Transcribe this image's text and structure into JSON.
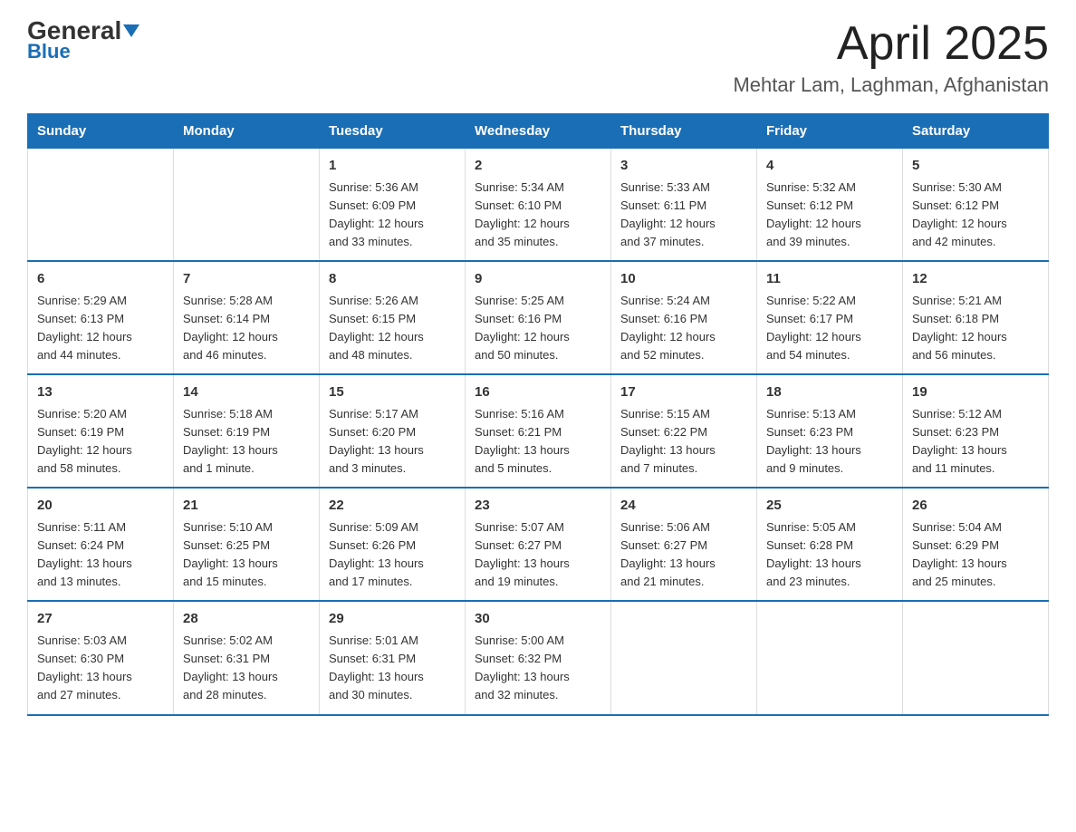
{
  "header": {
    "logo_general": "General",
    "logo_blue": "Blue",
    "month_title": "April 2025",
    "location": "Mehtar Lam, Laghman, Afghanistan"
  },
  "days_of_week": [
    "Sunday",
    "Monday",
    "Tuesday",
    "Wednesday",
    "Thursday",
    "Friday",
    "Saturday"
  ],
  "weeks": [
    [
      {
        "day": "",
        "details": []
      },
      {
        "day": "",
        "details": []
      },
      {
        "day": "1",
        "details": [
          "Sunrise: 5:36 AM",
          "Sunset: 6:09 PM",
          "Daylight: 12 hours",
          "and 33 minutes."
        ]
      },
      {
        "day": "2",
        "details": [
          "Sunrise: 5:34 AM",
          "Sunset: 6:10 PM",
          "Daylight: 12 hours",
          "and 35 minutes."
        ]
      },
      {
        "day": "3",
        "details": [
          "Sunrise: 5:33 AM",
          "Sunset: 6:11 PM",
          "Daylight: 12 hours",
          "and 37 minutes."
        ]
      },
      {
        "day": "4",
        "details": [
          "Sunrise: 5:32 AM",
          "Sunset: 6:12 PM",
          "Daylight: 12 hours",
          "and 39 minutes."
        ]
      },
      {
        "day": "5",
        "details": [
          "Sunrise: 5:30 AM",
          "Sunset: 6:12 PM",
          "Daylight: 12 hours",
          "and 42 minutes."
        ]
      }
    ],
    [
      {
        "day": "6",
        "details": [
          "Sunrise: 5:29 AM",
          "Sunset: 6:13 PM",
          "Daylight: 12 hours",
          "and 44 minutes."
        ]
      },
      {
        "day": "7",
        "details": [
          "Sunrise: 5:28 AM",
          "Sunset: 6:14 PM",
          "Daylight: 12 hours",
          "and 46 minutes."
        ]
      },
      {
        "day": "8",
        "details": [
          "Sunrise: 5:26 AM",
          "Sunset: 6:15 PM",
          "Daylight: 12 hours",
          "and 48 minutes."
        ]
      },
      {
        "day": "9",
        "details": [
          "Sunrise: 5:25 AM",
          "Sunset: 6:16 PM",
          "Daylight: 12 hours",
          "and 50 minutes."
        ]
      },
      {
        "day": "10",
        "details": [
          "Sunrise: 5:24 AM",
          "Sunset: 6:16 PM",
          "Daylight: 12 hours",
          "and 52 minutes."
        ]
      },
      {
        "day": "11",
        "details": [
          "Sunrise: 5:22 AM",
          "Sunset: 6:17 PM",
          "Daylight: 12 hours",
          "and 54 minutes."
        ]
      },
      {
        "day": "12",
        "details": [
          "Sunrise: 5:21 AM",
          "Sunset: 6:18 PM",
          "Daylight: 12 hours",
          "and 56 minutes."
        ]
      }
    ],
    [
      {
        "day": "13",
        "details": [
          "Sunrise: 5:20 AM",
          "Sunset: 6:19 PM",
          "Daylight: 12 hours",
          "and 58 minutes."
        ]
      },
      {
        "day": "14",
        "details": [
          "Sunrise: 5:18 AM",
          "Sunset: 6:19 PM",
          "Daylight: 13 hours",
          "and 1 minute."
        ]
      },
      {
        "day": "15",
        "details": [
          "Sunrise: 5:17 AM",
          "Sunset: 6:20 PM",
          "Daylight: 13 hours",
          "and 3 minutes."
        ]
      },
      {
        "day": "16",
        "details": [
          "Sunrise: 5:16 AM",
          "Sunset: 6:21 PM",
          "Daylight: 13 hours",
          "and 5 minutes."
        ]
      },
      {
        "day": "17",
        "details": [
          "Sunrise: 5:15 AM",
          "Sunset: 6:22 PM",
          "Daylight: 13 hours",
          "and 7 minutes."
        ]
      },
      {
        "day": "18",
        "details": [
          "Sunrise: 5:13 AM",
          "Sunset: 6:23 PM",
          "Daylight: 13 hours",
          "and 9 minutes."
        ]
      },
      {
        "day": "19",
        "details": [
          "Sunrise: 5:12 AM",
          "Sunset: 6:23 PM",
          "Daylight: 13 hours",
          "and 11 minutes."
        ]
      }
    ],
    [
      {
        "day": "20",
        "details": [
          "Sunrise: 5:11 AM",
          "Sunset: 6:24 PM",
          "Daylight: 13 hours",
          "and 13 minutes."
        ]
      },
      {
        "day": "21",
        "details": [
          "Sunrise: 5:10 AM",
          "Sunset: 6:25 PM",
          "Daylight: 13 hours",
          "and 15 minutes."
        ]
      },
      {
        "day": "22",
        "details": [
          "Sunrise: 5:09 AM",
          "Sunset: 6:26 PM",
          "Daylight: 13 hours",
          "and 17 minutes."
        ]
      },
      {
        "day": "23",
        "details": [
          "Sunrise: 5:07 AM",
          "Sunset: 6:27 PM",
          "Daylight: 13 hours",
          "and 19 minutes."
        ]
      },
      {
        "day": "24",
        "details": [
          "Sunrise: 5:06 AM",
          "Sunset: 6:27 PM",
          "Daylight: 13 hours",
          "and 21 minutes."
        ]
      },
      {
        "day": "25",
        "details": [
          "Sunrise: 5:05 AM",
          "Sunset: 6:28 PM",
          "Daylight: 13 hours",
          "and 23 minutes."
        ]
      },
      {
        "day": "26",
        "details": [
          "Sunrise: 5:04 AM",
          "Sunset: 6:29 PM",
          "Daylight: 13 hours",
          "and 25 minutes."
        ]
      }
    ],
    [
      {
        "day": "27",
        "details": [
          "Sunrise: 5:03 AM",
          "Sunset: 6:30 PM",
          "Daylight: 13 hours",
          "and 27 minutes."
        ]
      },
      {
        "day": "28",
        "details": [
          "Sunrise: 5:02 AM",
          "Sunset: 6:31 PM",
          "Daylight: 13 hours",
          "and 28 minutes."
        ]
      },
      {
        "day": "29",
        "details": [
          "Sunrise: 5:01 AM",
          "Sunset: 6:31 PM",
          "Daylight: 13 hours",
          "and 30 minutes."
        ]
      },
      {
        "day": "30",
        "details": [
          "Sunrise: 5:00 AM",
          "Sunset: 6:32 PM",
          "Daylight: 13 hours",
          "and 32 minutes."
        ]
      },
      {
        "day": "",
        "details": []
      },
      {
        "day": "",
        "details": []
      },
      {
        "day": "",
        "details": []
      }
    ]
  ]
}
